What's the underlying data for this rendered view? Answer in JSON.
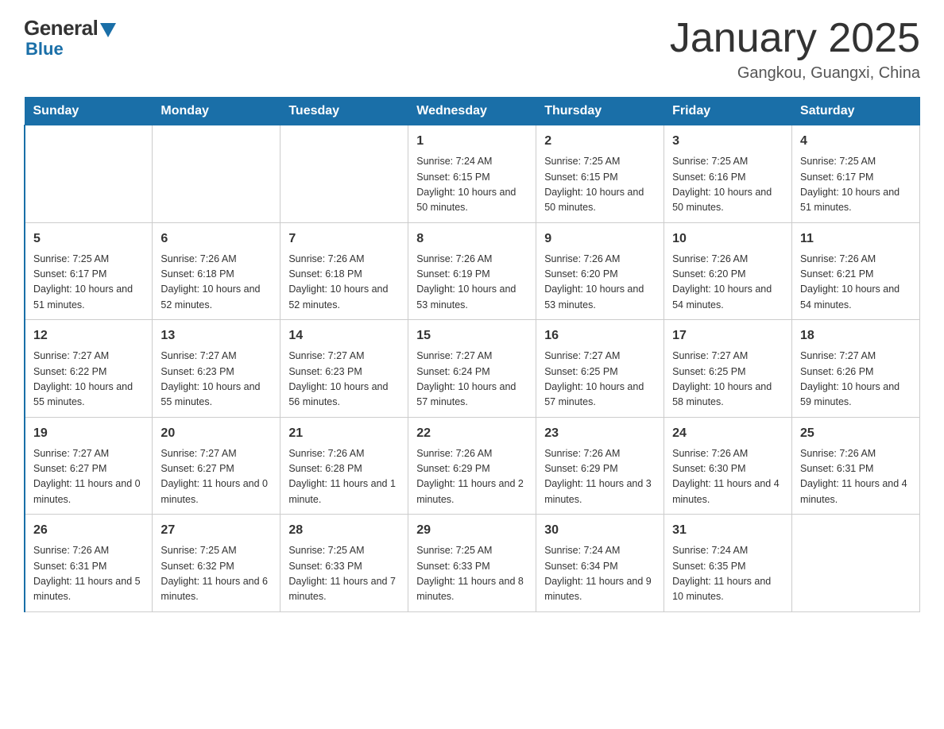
{
  "header": {
    "logo_general": "General",
    "logo_blue": "Blue",
    "month_title": "January 2025",
    "location": "Gangkou, Guangxi, China"
  },
  "days_of_week": [
    "Sunday",
    "Monday",
    "Tuesday",
    "Wednesday",
    "Thursday",
    "Friday",
    "Saturday"
  ],
  "weeks": [
    [
      null,
      null,
      null,
      {
        "day": "1",
        "sunrise": "Sunrise: 7:24 AM",
        "sunset": "Sunset: 6:15 PM",
        "daylight": "Daylight: 10 hours and 50 minutes."
      },
      {
        "day": "2",
        "sunrise": "Sunrise: 7:25 AM",
        "sunset": "Sunset: 6:15 PM",
        "daylight": "Daylight: 10 hours and 50 minutes."
      },
      {
        "day": "3",
        "sunrise": "Sunrise: 7:25 AM",
        "sunset": "Sunset: 6:16 PM",
        "daylight": "Daylight: 10 hours and 50 minutes."
      },
      {
        "day": "4",
        "sunrise": "Sunrise: 7:25 AM",
        "sunset": "Sunset: 6:17 PM",
        "daylight": "Daylight: 10 hours and 51 minutes."
      }
    ],
    [
      {
        "day": "5",
        "sunrise": "Sunrise: 7:25 AM",
        "sunset": "Sunset: 6:17 PM",
        "daylight": "Daylight: 10 hours and 51 minutes."
      },
      {
        "day": "6",
        "sunrise": "Sunrise: 7:26 AM",
        "sunset": "Sunset: 6:18 PM",
        "daylight": "Daylight: 10 hours and 52 minutes."
      },
      {
        "day": "7",
        "sunrise": "Sunrise: 7:26 AM",
        "sunset": "Sunset: 6:18 PM",
        "daylight": "Daylight: 10 hours and 52 minutes."
      },
      {
        "day": "8",
        "sunrise": "Sunrise: 7:26 AM",
        "sunset": "Sunset: 6:19 PM",
        "daylight": "Daylight: 10 hours and 53 minutes."
      },
      {
        "day": "9",
        "sunrise": "Sunrise: 7:26 AM",
        "sunset": "Sunset: 6:20 PM",
        "daylight": "Daylight: 10 hours and 53 minutes."
      },
      {
        "day": "10",
        "sunrise": "Sunrise: 7:26 AM",
        "sunset": "Sunset: 6:20 PM",
        "daylight": "Daylight: 10 hours and 54 minutes."
      },
      {
        "day": "11",
        "sunrise": "Sunrise: 7:26 AM",
        "sunset": "Sunset: 6:21 PM",
        "daylight": "Daylight: 10 hours and 54 minutes."
      }
    ],
    [
      {
        "day": "12",
        "sunrise": "Sunrise: 7:27 AM",
        "sunset": "Sunset: 6:22 PM",
        "daylight": "Daylight: 10 hours and 55 minutes."
      },
      {
        "day": "13",
        "sunrise": "Sunrise: 7:27 AM",
        "sunset": "Sunset: 6:23 PM",
        "daylight": "Daylight: 10 hours and 55 minutes."
      },
      {
        "day": "14",
        "sunrise": "Sunrise: 7:27 AM",
        "sunset": "Sunset: 6:23 PM",
        "daylight": "Daylight: 10 hours and 56 minutes."
      },
      {
        "day": "15",
        "sunrise": "Sunrise: 7:27 AM",
        "sunset": "Sunset: 6:24 PM",
        "daylight": "Daylight: 10 hours and 57 minutes."
      },
      {
        "day": "16",
        "sunrise": "Sunrise: 7:27 AM",
        "sunset": "Sunset: 6:25 PM",
        "daylight": "Daylight: 10 hours and 57 minutes."
      },
      {
        "day": "17",
        "sunrise": "Sunrise: 7:27 AM",
        "sunset": "Sunset: 6:25 PM",
        "daylight": "Daylight: 10 hours and 58 minutes."
      },
      {
        "day": "18",
        "sunrise": "Sunrise: 7:27 AM",
        "sunset": "Sunset: 6:26 PM",
        "daylight": "Daylight: 10 hours and 59 minutes."
      }
    ],
    [
      {
        "day": "19",
        "sunrise": "Sunrise: 7:27 AM",
        "sunset": "Sunset: 6:27 PM",
        "daylight": "Daylight: 11 hours and 0 minutes."
      },
      {
        "day": "20",
        "sunrise": "Sunrise: 7:27 AM",
        "sunset": "Sunset: 6:27 PM",
        "daylight": "Daylight: 11 hours and 0 minutes."
      },
      {
        "day": "21",
        "sunrise": "Sunrise: 7:26 AM",
        "sunset": "Sunset: 6:28 PM",
        "daylight": "Daylight: 11 hours and 1 minute."
      },
      {
        "day": "22",
        "sunrise": "Sunrise: 7:26 AM",
        "sunset": "Sunset: 6:29 PM",
        "daylight": "Daylight: 11 hours and 2 minutes."
      },
      {
        "day": "23",
        "sunrise": "Sunrise: 7:26 AM",
        "sunset": "Sunset: 6:29 PM",
        "daylight": "Daylight: 11 hours and 3 minutes."
      },
      {
        "day": "24",
        "sunrise": "Sunrise: 7:26 AM",
        "sunset": "Sunset: 6:30 PM",
        "daylight": "Daylight: 11 hours and 4 minutes."
      },
      {
        "day": "25",
        "sunrise": "Sunrise: 7:26 AM",
        "sunset": "Sunset: 6:31 PM",
        "daylight": "Daylight: 11 hours and 4 minutes."
      }
    ],
    [
      {
        "day": "26",
        "sunrise": "Sunrise: 7:26 AM",
        "sunset": "Sunset: 6:31 PM",
        "daylight": "Daylight: 11 hours and 5 minutes."
      },
      {
        "day": "27",
        "sunrise": "Sunrise: 7:25 AM",
        "sunset": "Sunset: 6:32 PM",
        "daylight": "Daylight: 11 hours and 6 minutes."
      },
      {
        "day": "28",
        "sunrise": "Sunrise: 7:25 AM",
        "sunset": "Sunset: 6:33 PM",
        "daylight": "Daylight: 11 hours and 7 minutes."
      },
      {
        "day": "29",
        "sunrise": "Sunrise: 7:25 AM",
        "sunset": "Sunset: 6:33 PM",
        "daylight": "Daylight: 11 hours and 8 minutes."
      },
      {
        "day": "30",
        "sunrise": "Sunrise: 7:24 AM",
        "sunset": "Sunset: 6:34 PM",
        "daylight": "Daylight: 11 hours and 9 minutes."
      },
      {
        "day": "31",
        "sunrise": "Sunrise: 7:24 AM",
        "sunset": "Sunset: 6:35 PM",
        "daylight": "Daylight: 11 hours and 10 minutes."
      },
      null
    ]
  ]
}
